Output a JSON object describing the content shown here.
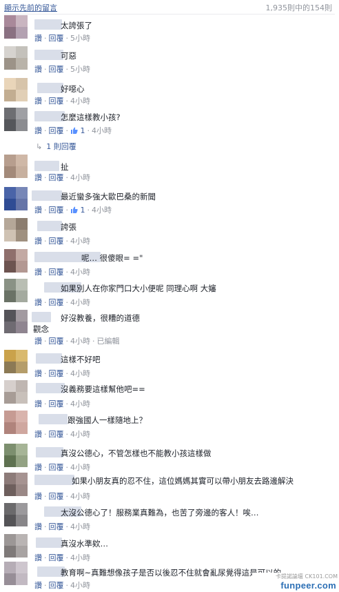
{
  "header": {
    "prev_link": "顯示先前的留言",
    "count": "1,935則中的154則"
  },
  "actions": {
    "read": "讚",
    "reply": "回覆",
    "dot": "·"
  },
  "comments": [
    {
      "text": "太誇張了",
      "time": "5小時"
    },
    {
      "text": "可惡",
      "time": "5小時"
    },
    {
      "text": "好噁心",
      "time": "4小時"
    },
    {
      "text": "怎麼這樣教小孩?",
      "time": "4小時",
      "likes": "1",
      "replies": "1 則回覆"
    },
    {
      "text": "扯",
      "time": "4小時"
    },
    {
      "text": "最近蠻多強大歐巴桑的新聞",
      "time": "4小時",
      "likes": "1"
    },
    {
      "text": "誇張",
      "time": "4小時"
    },
    {
      "text": "呢…  很傻眼= =\"",
      "time": "4小時"
    },
    {
      "text": "如果別人在你家門口大小便呢 同理心啊 大嬸",
      "time": "4小時"
    },
    {
      "text": "好沒教養，很糟的道德",
      "text2": "觀念",
      "time": "4小時",
      "edited": "已編輯"
    },
    {
      "text": "這樣不好吧",
      "time": "4小時"
    },
    {
      "text": "沒義務要這樣幫他吧==",
      "time": "4小時"
    },
    {
      "text": "跟強國人一樣隨地上？",
      "time": "4小時"
    },
    {
      "text": "真沒公德心，不管怎樣也不能教小孩這樣做",
      "time": "4小時"
    },
    {
      "text": "如果小朋友真的忍不住，這位媽媽其實可以帶小朋友去路邊解決",
      "time": "4小時"
    },
    {
      "text": "太沒公德心了！服務業真難為，也苦了旁邊的客人！唉…",
      "time": "4小時"
    },
    {
      "text": "真沒水準欸…",
      "time": "4小時"
    },
    {
      "text": "教育啊~真難想像孩子是否以後忍不住就會亂尿覺得這是可以的",
      "time": "4小時"
    }
  ],
  "watermark": {
    "top": "卡提諾論壇 CK101.COM",
    "main": "funpeer.com"
  }
}
